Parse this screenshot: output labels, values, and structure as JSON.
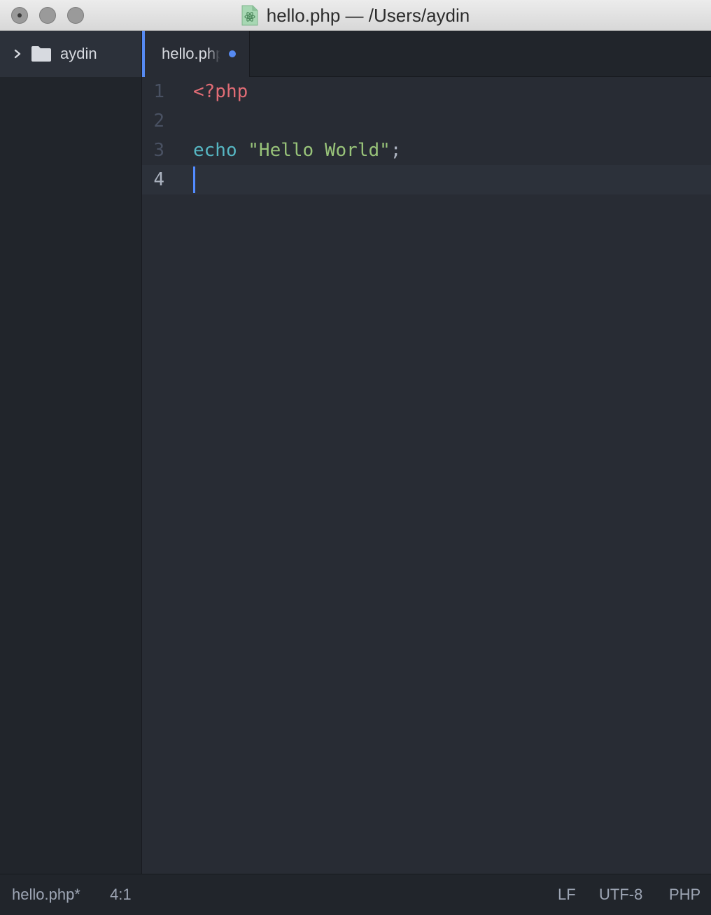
{
  "window": {
    "title": "hello.php — /Users/aydin"
  },
  "tree_view": {
    "project_name": "aydin"
  },
  "tabs": [
    {
      "label": "hello.php",
      "modified": true,
      "active": true
    }
  ],
  "editor": {
    "lines": [
      {
        "number": "1",
        "tokens": [
          {
            "text": "<?php",
            "type": "tag"
          }
        ]
      },
      {
        "number": "2",
        "tokens": []
      },
      {
        "number": "3",
        "tokens": [
          {
            "text": "echo",
            "type": "kw"
          },
          {
            "text": " ",
            "type": "punc"
          },
          {
            "text": "\"Hello World\"",
            "type": "str"
          },
          {
            "text": ";",
            "type": "punc"
          }
        ]
      },
      {
        "number": "4",
        "tokens": [],
        "current": true
      }
    ]
  },
  "status_bar": {
    "file": "hello.php*",
    "cursor_position": "4:1",
    "line_ending": "LF",
    "encoding": "UTF-8",
    "grammar": "PHP"
  },
  "colors": {
    "accent": "#568af2",
    "tag": "#e06c75",
    "keyword": "#56b6c2",
    "string": "#98c379"
  }
}
